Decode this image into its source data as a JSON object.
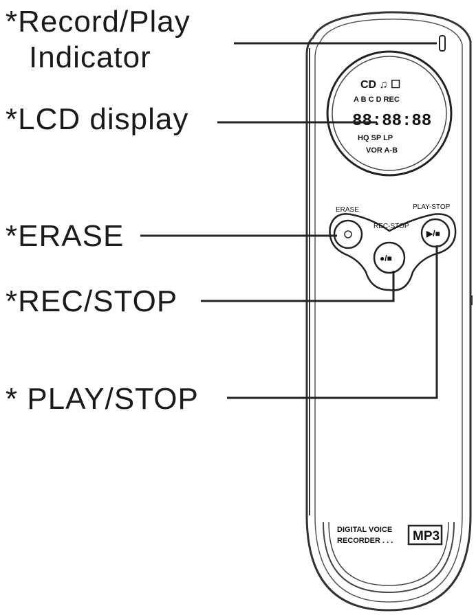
{
  "callouts": {
    "record_play": {
      "line1": "*Record/Play",
      "line2": "Indicator"
    },
    "lcd": "*LCD display",
    "erase": "*ERASE",
    "rec_stop": "*REC/STOP",
    "play_stop": "* PLAY/STOP"
  },
  "device": {
    "button_labels": {
      "erase": "ERASE",
      "rec_stop": "REC-STOP",
      "play_stop": "PLAY-STOP"
    },
    "button_glyphs": {
      "erase": "",
      "rec_stop": "●/■",
      "play_stop": "▶/■"
    },
    "lcd": {
      "row1": "CD ♫ ☐",
      "row2": "A B C D  REC",
      "digits": "88:88:88",
      "row4": "HQ SP LP",
      "row5": "VOR A-B"
    },
    "branding": {
      "line1": "DIGITAL VOICE",
      "line2": "RECORDER . . .",
      "logo": "MP3"
    }
  }
}
